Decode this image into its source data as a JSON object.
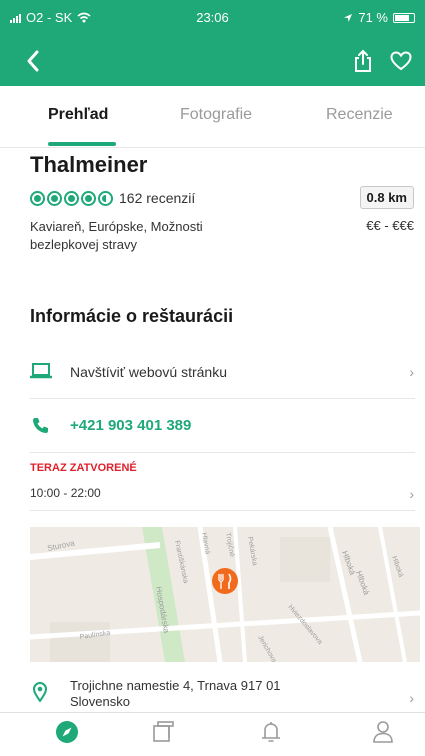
{
  "status": {
    "carrier": "O2 - SK",
    "time": "23:06",
    "battery": "71 %"
  },
  "tabs": [
    {
      "label": "Prehľad"
    },
    {
      "label": "Fotografie"
    },
    {
      "label": "Recenzie"
    }
  ],
  "restaurant": {
    "name": "Thalmeiner",
    "rating": 4.5,
    "reviews": "162 recenzií",
    "distance": "0.8 km",
    "cuisine": "Kaviareň, Európske, Možnosti bezlepkovej stravy",
    "price": "€€ - €€€"
  },
  "info": {
    "heading": "Informácie o reštaurácii",
    "website": "Navštíviť webovú stránku",
    "phone": "+421 903 401 389",
    "hours_status": "TERAZ ZATVORENÉ",
    "hours": "10:00 - 22:00",
    "address": "Trojichne namestie 4, Trnava 917 01 Slovensko"
  },
  "map": {
    "streets": [
      "Sturova",
      "Hospodárska",
      "Františkánska",
      "Hlavná",
      "Trojičné",
      "Pekárska",
      "Hlboká",
      "Hlboká",
      "Hviezdoslavova",
      "Paulínska",
      "Jerichova",
      "Hlboká"
    ]
  },
  "colors": {
    "brand": "#1fa878",
    "alert": "#e0202b",
    "pin": "#f26a1b"
  },
  "bottom_nav": [
    "compass-icon",
    "trips-icon",
    "notifications-icon",
    "profile-icon"
  ]
}
